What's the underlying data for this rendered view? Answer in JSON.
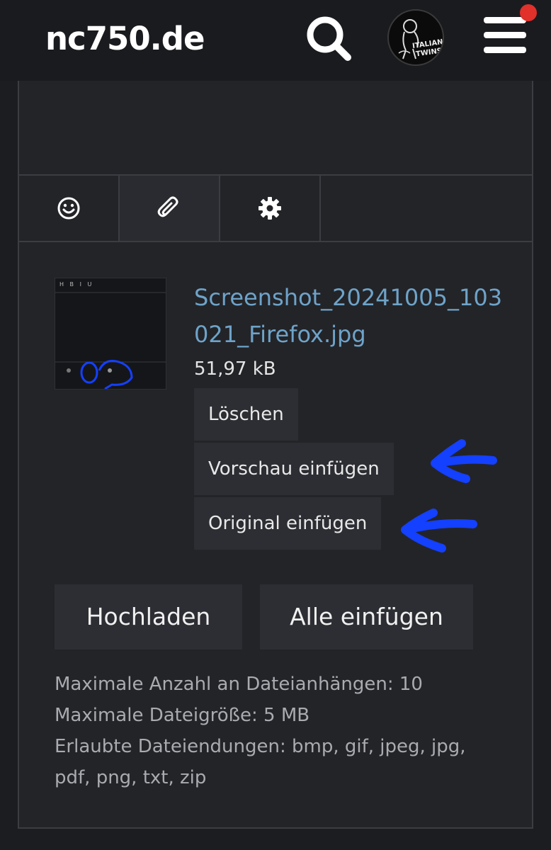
{
  "header": {
    "logo_text": "nc750.de",
    "avatar_text_line1": "ITALIAN",
    "avatar_text_line2": "TWINS",
    "notification_color": "#e2302a"
  },
  "toolbar": {
    "items": [
      {
        "icon": "smiley-icon"
      },
      {
        "icon": "paperclip-icon"
      },
      {
        "icon": "gear-icon"
      }
    ]
  },
  "attachment": {
    "file_name": "Screenshot_20241005_103021_Firefox.jpg",
    "file_size": "51,97 kB",
    "delete_label": "Löschen",
    "insert_preview_label": "Vorschau einfügen",
    "insert_original_label": "Original einfügen",
    "thumbnail_toolbar": "H  B  I  U"
  },
  "actions": {
    "upload_label": "Hochladen",
    "insert_all_label": "Alle einfügen"
  },
  "limits": {
    "max_count": "Maximale Anzahl an Dateianhängen: 10",
    "max_size": "Maximale Dateigröße: 5 MB",
    "allowed_types": "Erlaubte Dateiendungen: bmp, gif, jpeg, jpg, pdf, png, txt, zip"
  },
  "colors": {
    "link": "#6ea3c9",
    "annotation_arrow": "#1440ff",
    "background": "#1c1d21"
  }
}
